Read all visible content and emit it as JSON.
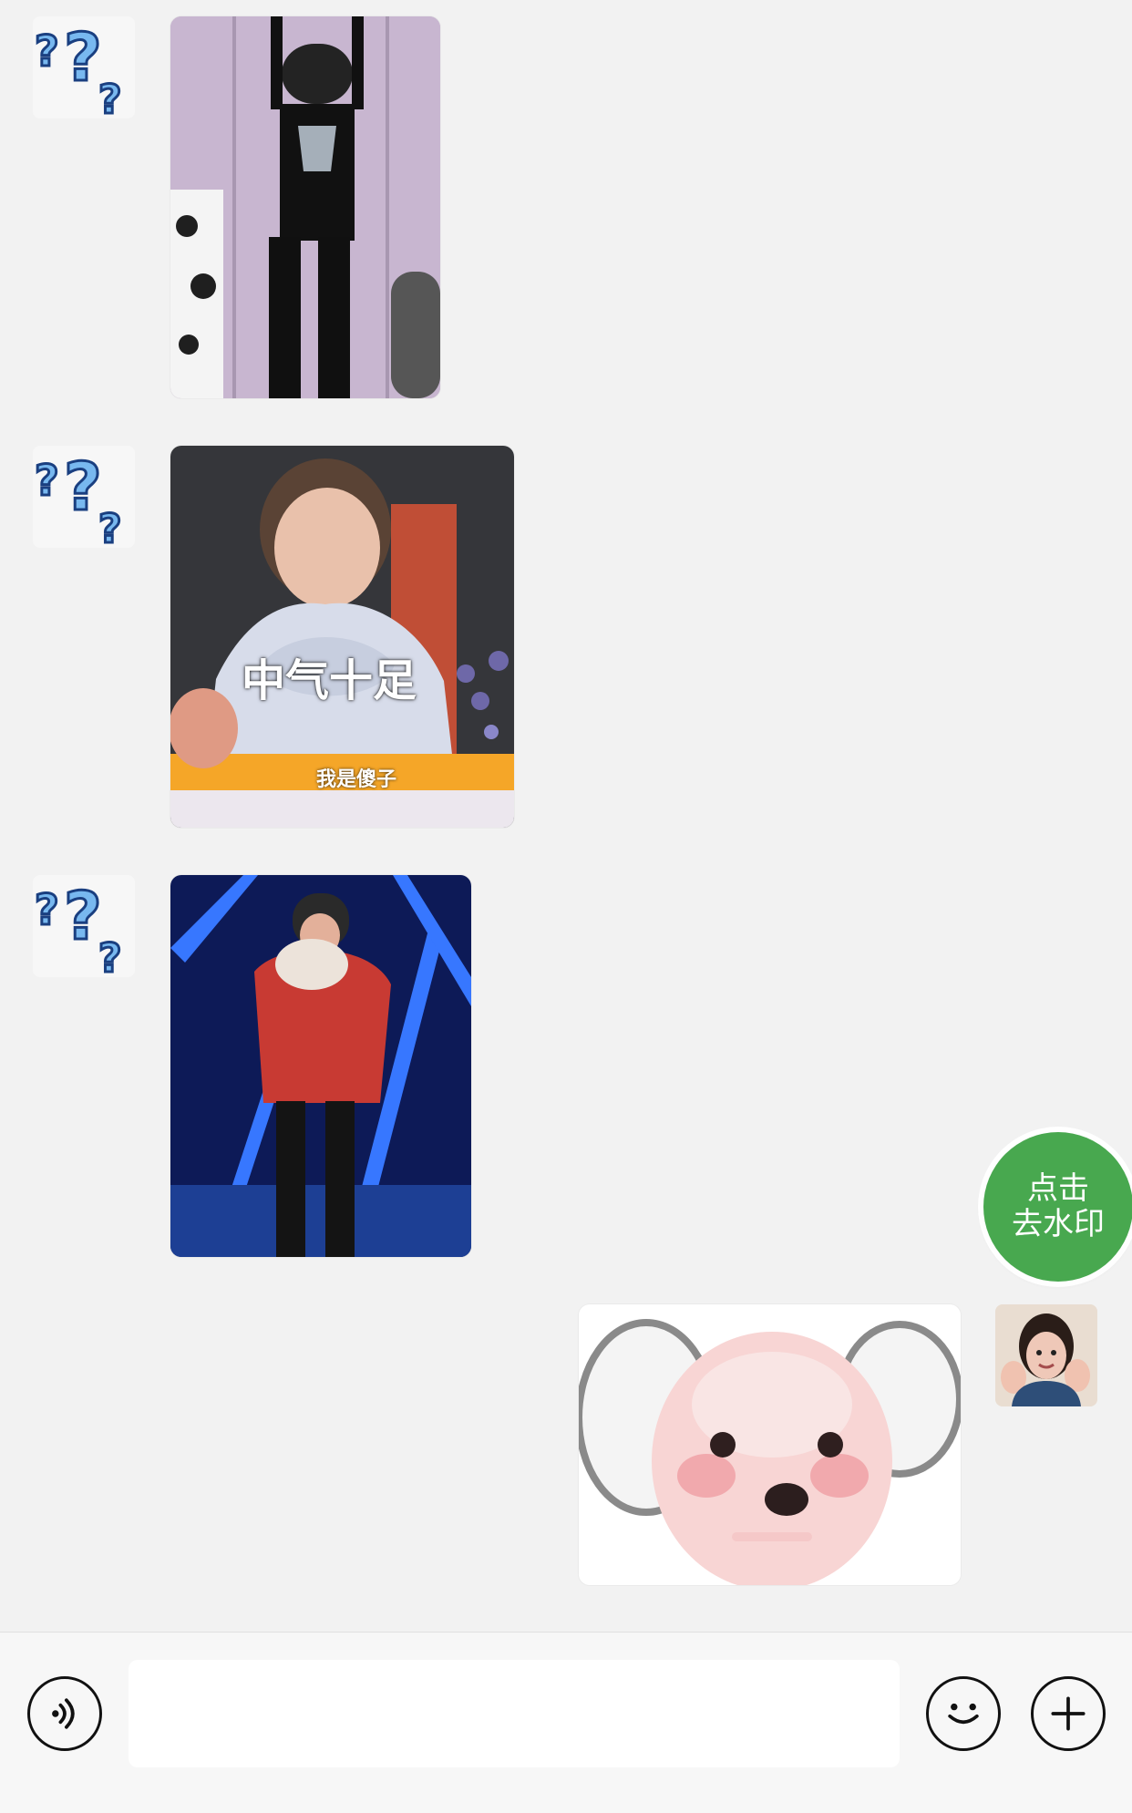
{
  "chat": {
    "messages": [
      {
        "sender": "contact",
        "avatar_icon": "question-marks-icon",
        "sticker_icon": "dancing-boy-sticker",
        "caption": "",
        "subcaption": ""
      },
      {
        "sender": "contact",
        "avatar_icon": "question-marks-icon",
        "sticker_icon": "smiling-boy-hoodie-sticker",
        "caption": "中气十足",
        "subcaption": "我是傻子"
      },
      {
        "sender": "contact",
        "avatar_icon": "question-marks-icon",
        "sticker_icon": "boy-with-plush-on-stage-sticker",
        "caption": "",
        "subcaption": ""
      },
      {
        "sender": "self",
        "avatar_icon": "girl-selfie-avatar",
        "sticker_icon": "pink-puppy-face-sticker",
        "caption": "",
        "subcaption": ""
      }
    ]
  },
  "floating_action": {
    "line1": "点击",
    "line2": "去水印",
    "color": "#48a84f"
  },
  "input_bar": {
    "voice_icon": "voice-icon",
    "emoji_icon": "emoji-icon",
    "plus_icon": "plus-icon",
    "text_value": ""
  },
  "colors": {
    "background": "#f2f2f2",
    "input_bar": "#f7f7f7"
  }
}
